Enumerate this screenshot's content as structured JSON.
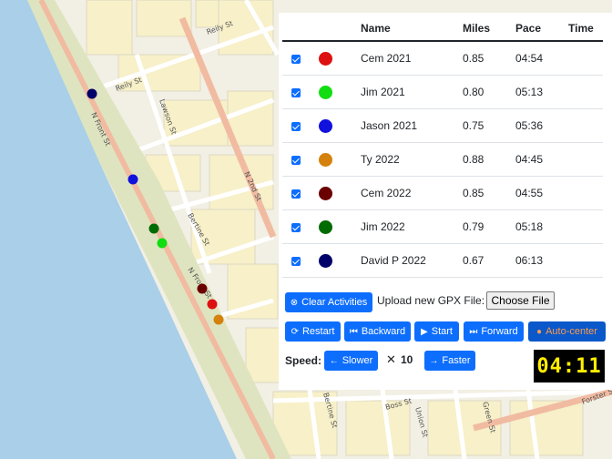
{
  "map": {
    "street_labels": [
      "N Front St",
      "Reily St",
      "Lawson St",
      "Bertine St",
      "N 2nd St",
      "N Front St",
      "Reily St",
      "Boss St",
      "Bertine St",
      "Union St",
      "Green St",
      "Forster St"
    ]
  },
  "table": {
    "headers": [
      "Name",
      "Miles",
      "Pace",
      "Time"
    ],
    "rows": [
      {
        "name": "Cem 2021",
        "miles": "0.85",
        "pace": "04:54",
        "color": "#dd1111",
        "checked": true
      },
      {
        "name": "Jim 2021",
        "miles": "0.80",
        "pace": "05:13",
        "color": "#11dd11",
        "checked": true
      },
      {
        "name": "Jason 2021",
        "miles": "0.75",
        "pace": "05:36",
        "color": "#1111dd",
        "checked": true
      },
      {
        "name": "Ty 2022",
        "miles": "0.88",
        "pace": "04:45",
        "color": "#d4820d",
        "checked": true
      },
      {
        "name": "Cem 2022",
        "miles": "0.85",
        "pace": "04:55",
        "color": "#6b0000",
        "checked": true
      },
      {
        "name": "Jim 2022",
        "miles": "0.79",
        "pace": "05:18",
        "color": "#006b00",
        "checked": true
      },
      {
        "name": "David P 2022",
        "miles": "0.67",
        "pace": "06:13",
        "color": "#00006b",
        "checked": true
      }
    ]
  },
  "controls": {
    "clear_label": "Clear Activities",
    "upload_label": "Upload new GPX File:",
    "choose_file_label": "Choose File",
    "restart_label": "Restart",
    "backward_label": "Backward",
    "start_label": "Start",
    "forward_label": "Forward",
    "autocenter_label": "Auto-center",
    "speed_label": "Speed:",
    "slower_label": "Slower",
    "speed_multiplier_symbol": "✕",
    "speed_value": "10",
    "faster_label": "Faster"
  },
  "clock": "04:11",
  "runners": [
    {
      "color": "#00006b"
    },
    {
      "color": "#1111dd"
    },
    {
      "color": "#006b00"
    },
    {
      "color": "#11dd11"
    },
    {
      "color": "#6b0000"
    },
    {
      "color": "#dd1111"
    },
    {
      "color": "#d4820d"
    }
  ]
}
